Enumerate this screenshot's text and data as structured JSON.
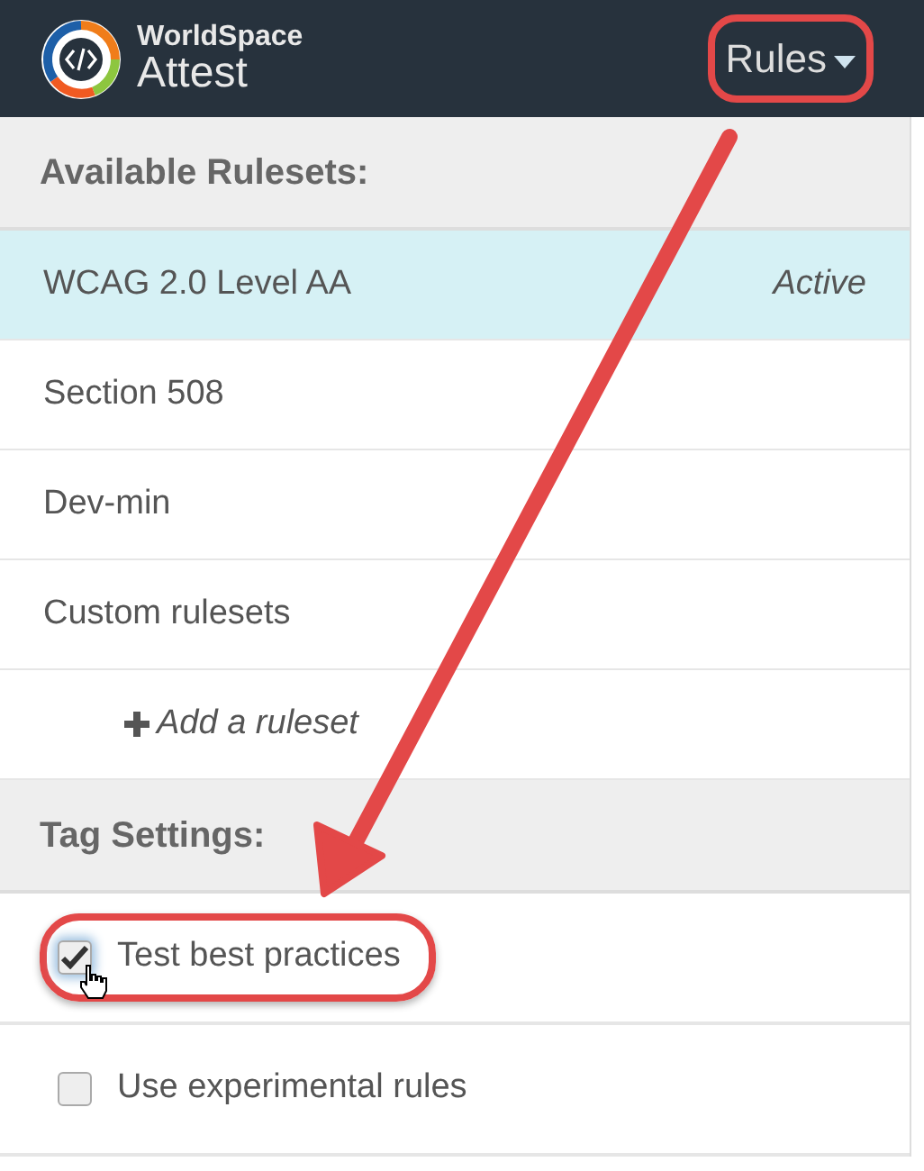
{
  "header": {
    "brand_top": "WorldSpace",
    "brand_bottom": "Attest",
    "menu": {
      "label": "Rules",
      "highlighted": true
    }
  },
  "rulesets": {
    "title": "Available Rulesets:",
    "items": [
      {
        "kind": "ruleset",
        "label": "WCAG 2.0 Level AA",
        "selected": true,
        "status": "Active"
      },
      {
        "kind": "ruleset",
        "label": "Section 508",
        "selected": false
      },
      {
        "kind": "ruleset",
        "label": "Dev-min",
        "selected": false
      },
      {
        "kind": "ruleset",
        "label": "Custom rulesets",
        "selected": false
      },
      {
        "kind": "add",
        "label": "Add a ruleset",
        "selected": false
      }
    ]
  },
  "tags": {
    "title": "Tag Settings:",
    "items": [
      {
        "label": "Test best practices",
        "checked": true,
        "highlighted": true,
        "hover": true
      },
      {
        "label": "Use experimental rules",
        "checked": false,
        "highlighted": false,
        "hover": false
      }
    ]
  }
}
